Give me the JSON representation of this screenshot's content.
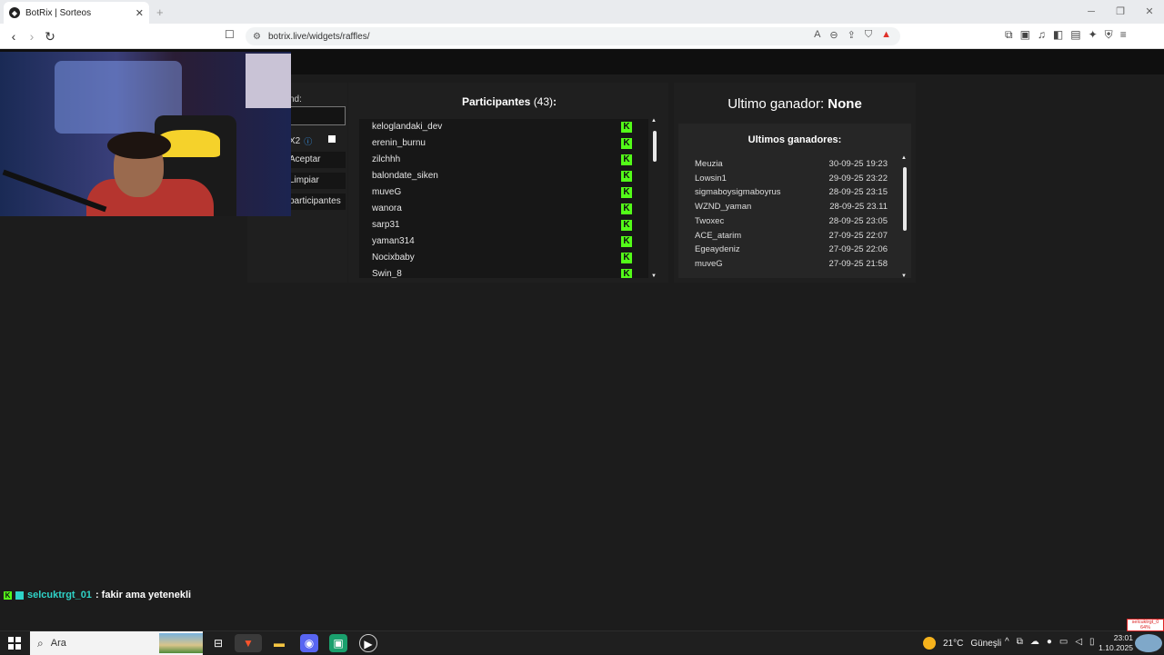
{
  "browser": {
    "tab_title": "BotRix | Sorteos",
    "tab_close": "✕",
    "new_tab": "+",
    "url": "botrix.live/widgets/raffles/",
    "brave_badge": "1"
  },
  "panel_left": {
    "field_label": "nd:",
    "x2_label": "X2",
    "info_icon": "ⓘ",
    "accept_label": "Aceptar",
    "clear_label": "Limpiar",
    "participants_label": "participantes"
  },
  "participants": {
    "title": "Participantes",
    "count": "(43)",
    "colon": ":",
    "items": [
      {
        "name": "keloglandaki_dev"
      },
      {
        "name": "erenin_burnu"
      },
      {
        "name": "zilchhh"
      },
      {
        "name": "balondate_siken"
      },
      {
        "name": "muveG"
      },
      {
        "name": "wanora"
      },
      {
        "name": "sarp31"
      },
      {
        "name": "yaman314"
      },
      {
        "name": "Nocixbaby"
      },
      {
        "name": "Swin_8"
      }
    ]
  },
  "winner": {
    "label": "Ultimo ganador:",
    "value": "None",
    "recent_title": "Ultimos ganadores:",
    "recent": [
      {
        "name": "Meuzia",
        "date": "30-09-25 19:23"
      },
      {
        "name": "Lowsin1",
        "date": "29-09-25 23:22"
      },
      {
        "name": "sigmaboysigmaboyrus",
        "date": "28-09-25 23:15"
      },
      {
        "name": "WZND_yaman",
        "date": "28-09-25 23.11"
      },
      {
        "name": "Twoxec",
        "date": "28-09-25 23:05"
      },
      {
        "name": "ACE_atarim",
        "date": "27-09-25 22:07"
      },
      {
        "name": "Egeaydeniz",
        "date": "27-09-25 22:06"
      },
      {
        "name": "muveG",
        "date": "27-09-25 21:58"
      }
    ]
  },
  "chat": {
    "username": "selcuktrgt_01",
    "message": ": fakir ama yetenekli"
  },
  "taskbar": {
    "search_placeholder": "Ara",
    "weather_temp": "21°C",
    "weather_text": "Güneşli",
    "time": "23:01",
    "date": "1.10.2025"
  },
  "toast": {
    "line1": "selcuktrgt_0",
    "line2": "64%"
  },
  "colors": {
    "kick_green": "#53fc18",
    "panel_bg": "#1f1f1f",
    "page_bg": "#1c1c1c"
  }
}
